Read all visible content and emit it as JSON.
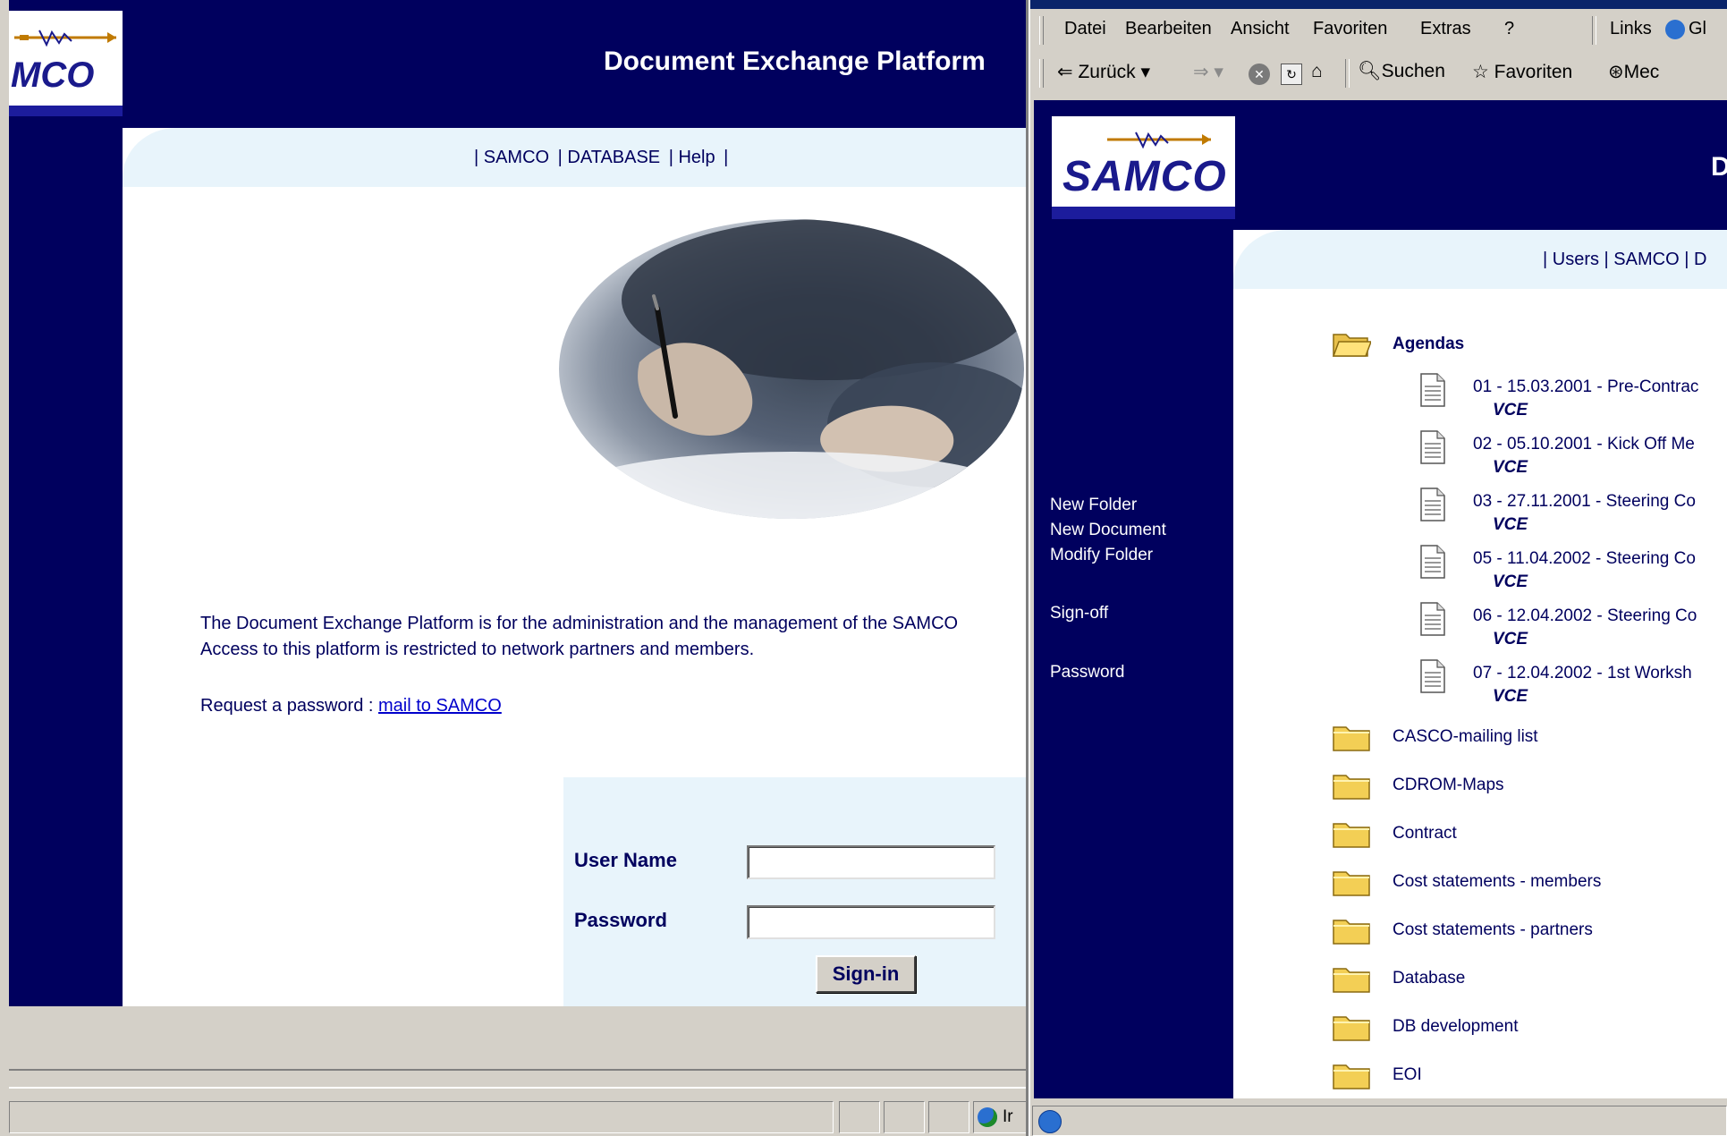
{
  "left_window": {
    "logo_text": "MCO",
    "title": "Document Exchange Platform",
    "nav": [
      "| SAMCO",
      "| DATABASE",
      "| Help",
      "|"
    ],
    "description_lines": [
      "The Document Exchange Platform is for the administration and the management of the SAMCO",
      "Access to this platform is restricted to network partners and members."
    ],
    "request_label": "Request a password :",
    "request_link": "mail to SAMCO",
    "login": {
      "user_label": "User Name",
      "user_value": "",
      "password_label": "Password",
      "password_value": "",
      "signin_label": "Sign-in"
    },
    "status_text": "Ir"
  },
  "right_window": {
    "menu": [
      "Datei",
      "Bearbeiten",
      "Ansicht",
      "Favoriten",
      "Extras",
      "?"
    ],
    "links_label": "Links",
    "links_item": "Gl",
    "toolbar": {
      "back": "Zurück",
      "search": "Suchen",
      "favorites": "Favoriten",
      "media": "Mec"
    },
    "logo_text": "SAMCO",
    "title_fragment": "D",
    "nav": [
      "| Users",
      "| SAMCO",
      "| D"
    ],
    "side_links": [
      "New Folder",
      "New Document",
      "Modify Folder",
      "Sign-off",
      "Password"
    ],
    "open_folder": "Agendas",
    "documents": [
      {
        "name": "01 - 15.03.2001 - Pre-Contrac",
        "author": "VCE"
      },
      {
        "name": "02 - 05.10.2001 - Kick Off Me",
        "author": "VCE"
      },
      {
        "name": "03 - 27.11.2001 - Steering Co",
        "author": "VCE"
      },
      {
        "name": "05 - 11.04.2002 - Steering Co",
        "author": "VCE"
      },
      {
        "name": "06 - 12.04.2002 - Steering Co",
        "author": "VCE"
      },
      {
        "name": "07 - 12.04.2002 - 1st Worksh",
        "author": "VCE"
      }
    ],
    "folders": [
      "CASCO-mailing list",
      "CDROM-Maps",
      "Contract",
      "Cost statements - members",
      "Cost statements - partners",
      "Database",
      "DB development",
      "EOI"
    ]
  },
  "colors": {
    "navy": "#00005e",
    "light_band": "#e8f4fb",
    "chrome": "#d4d0c8",
    "link": "#0000cc"
  }
}
